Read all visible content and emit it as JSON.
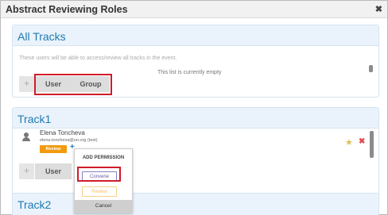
{
  "window": {
    "title": "Abstract Reviewing Roles",
    "close_glyph": "✖"
  },
  "all_tracks": {
    "title": "All Tracks",
    "hint": "These users will be able to access/review all tracks in the event.",
    "empty_text": "This list is currently empty",
    "plus_glyph": "+",
    "user_label": "User",
    "group_label": "Group"
  },
  "track1": {
    "title": "Track1",
    "user": {
      "name": "Elena Toncheva",
      "email": "elena.toncheva@un.org (test)",
      "role_badge": "Review",
      "add_glyph": "+"
    },
    "star_glyph": "★",
    "remove_glyph": "✖",
    "plus_glyph": "+",
    "user_label": "User"
  },
  "popup": {
    "heading": "ADD PERMISSION",
    "convene_label": "Convene",
    "review_label": "Review",
    "cancel_label": "Cancel"
  },
  "track2": {
    "title": "Track2"
  },
  "colors": {
    "accent_blue": "#1d7ab5",
    "header_bg": "#eaf3fb",
    "review_orange": "#f29b0f",
    "highlight_red": "#d11b2b"
  }
}
